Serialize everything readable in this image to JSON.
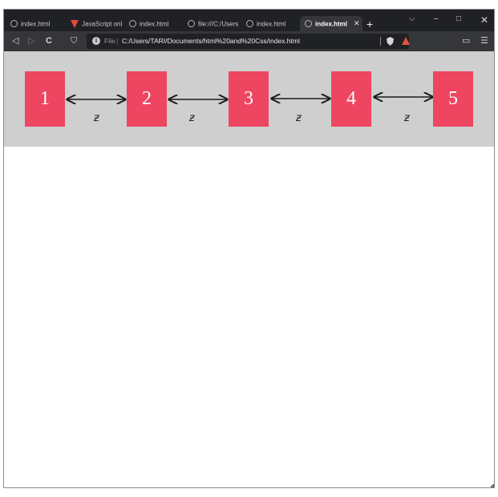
{
  "browser": {
    "tabs": [
      {
        "label": "index.html",
        "icon": "globe-icon"
      },
      {
        "label": "JavaScript onl",
        "icon": "brave-icon"
      },
      {
        "label": "index.html",
        "icon": "globe-icon"
      },
      {
        "label": "file:///C:/Users",
        "icon": "globe-icon"
      },
      {
        "label": "index.html",
        "icon": "globe-icon"
      },
      {
        "label": "index.html",
        "icon": "globe-icon",
        "active": true
      }
    ],
    "tab_close_glyph": "✕",
    "new_tab_glyph": "+",
    "window_buttons": {
      "collapse": "⌵",
      "minimize": "–",
      "maximize": "□",
      "close": "✕"
    },
    "toolbar": {
      "back_glyph": "◁",
      "forward_glyph": "▷",
      "reload_glyph": "C",
      "bookmark_glyph": "⛉",
      "url_info_glyph": "i",
      "url_scheme": "File",
      "url_separator": "|",
      "url": "C:/Users/TARI/Documents/html%20and%20Css/index.html",
      "wallet_glyph": "▭",
      "menu_glyph": "☰"
    },
    "accent_colors": {
      "tab_bg": "#202124",
      "toolbar_bg": "#35363a",
      "brave": "#e24b3b"
    }
  },
  "page": {
    "banner_color": "#cfcfcf",
    "box_color": "#ee4560",
    "boxes": [
      {
        "label": "1"
      },
      {
        "label": "2"
      },
      {
        "label": "3"
      },
      {
        "label": "4"
      },
      {
        "label": "5"
      }
    ],
    "connector_labels": [
      "ƶ",
      "ƶ",
      "ƶ",
      "ƶ"
    ]
  }
}
